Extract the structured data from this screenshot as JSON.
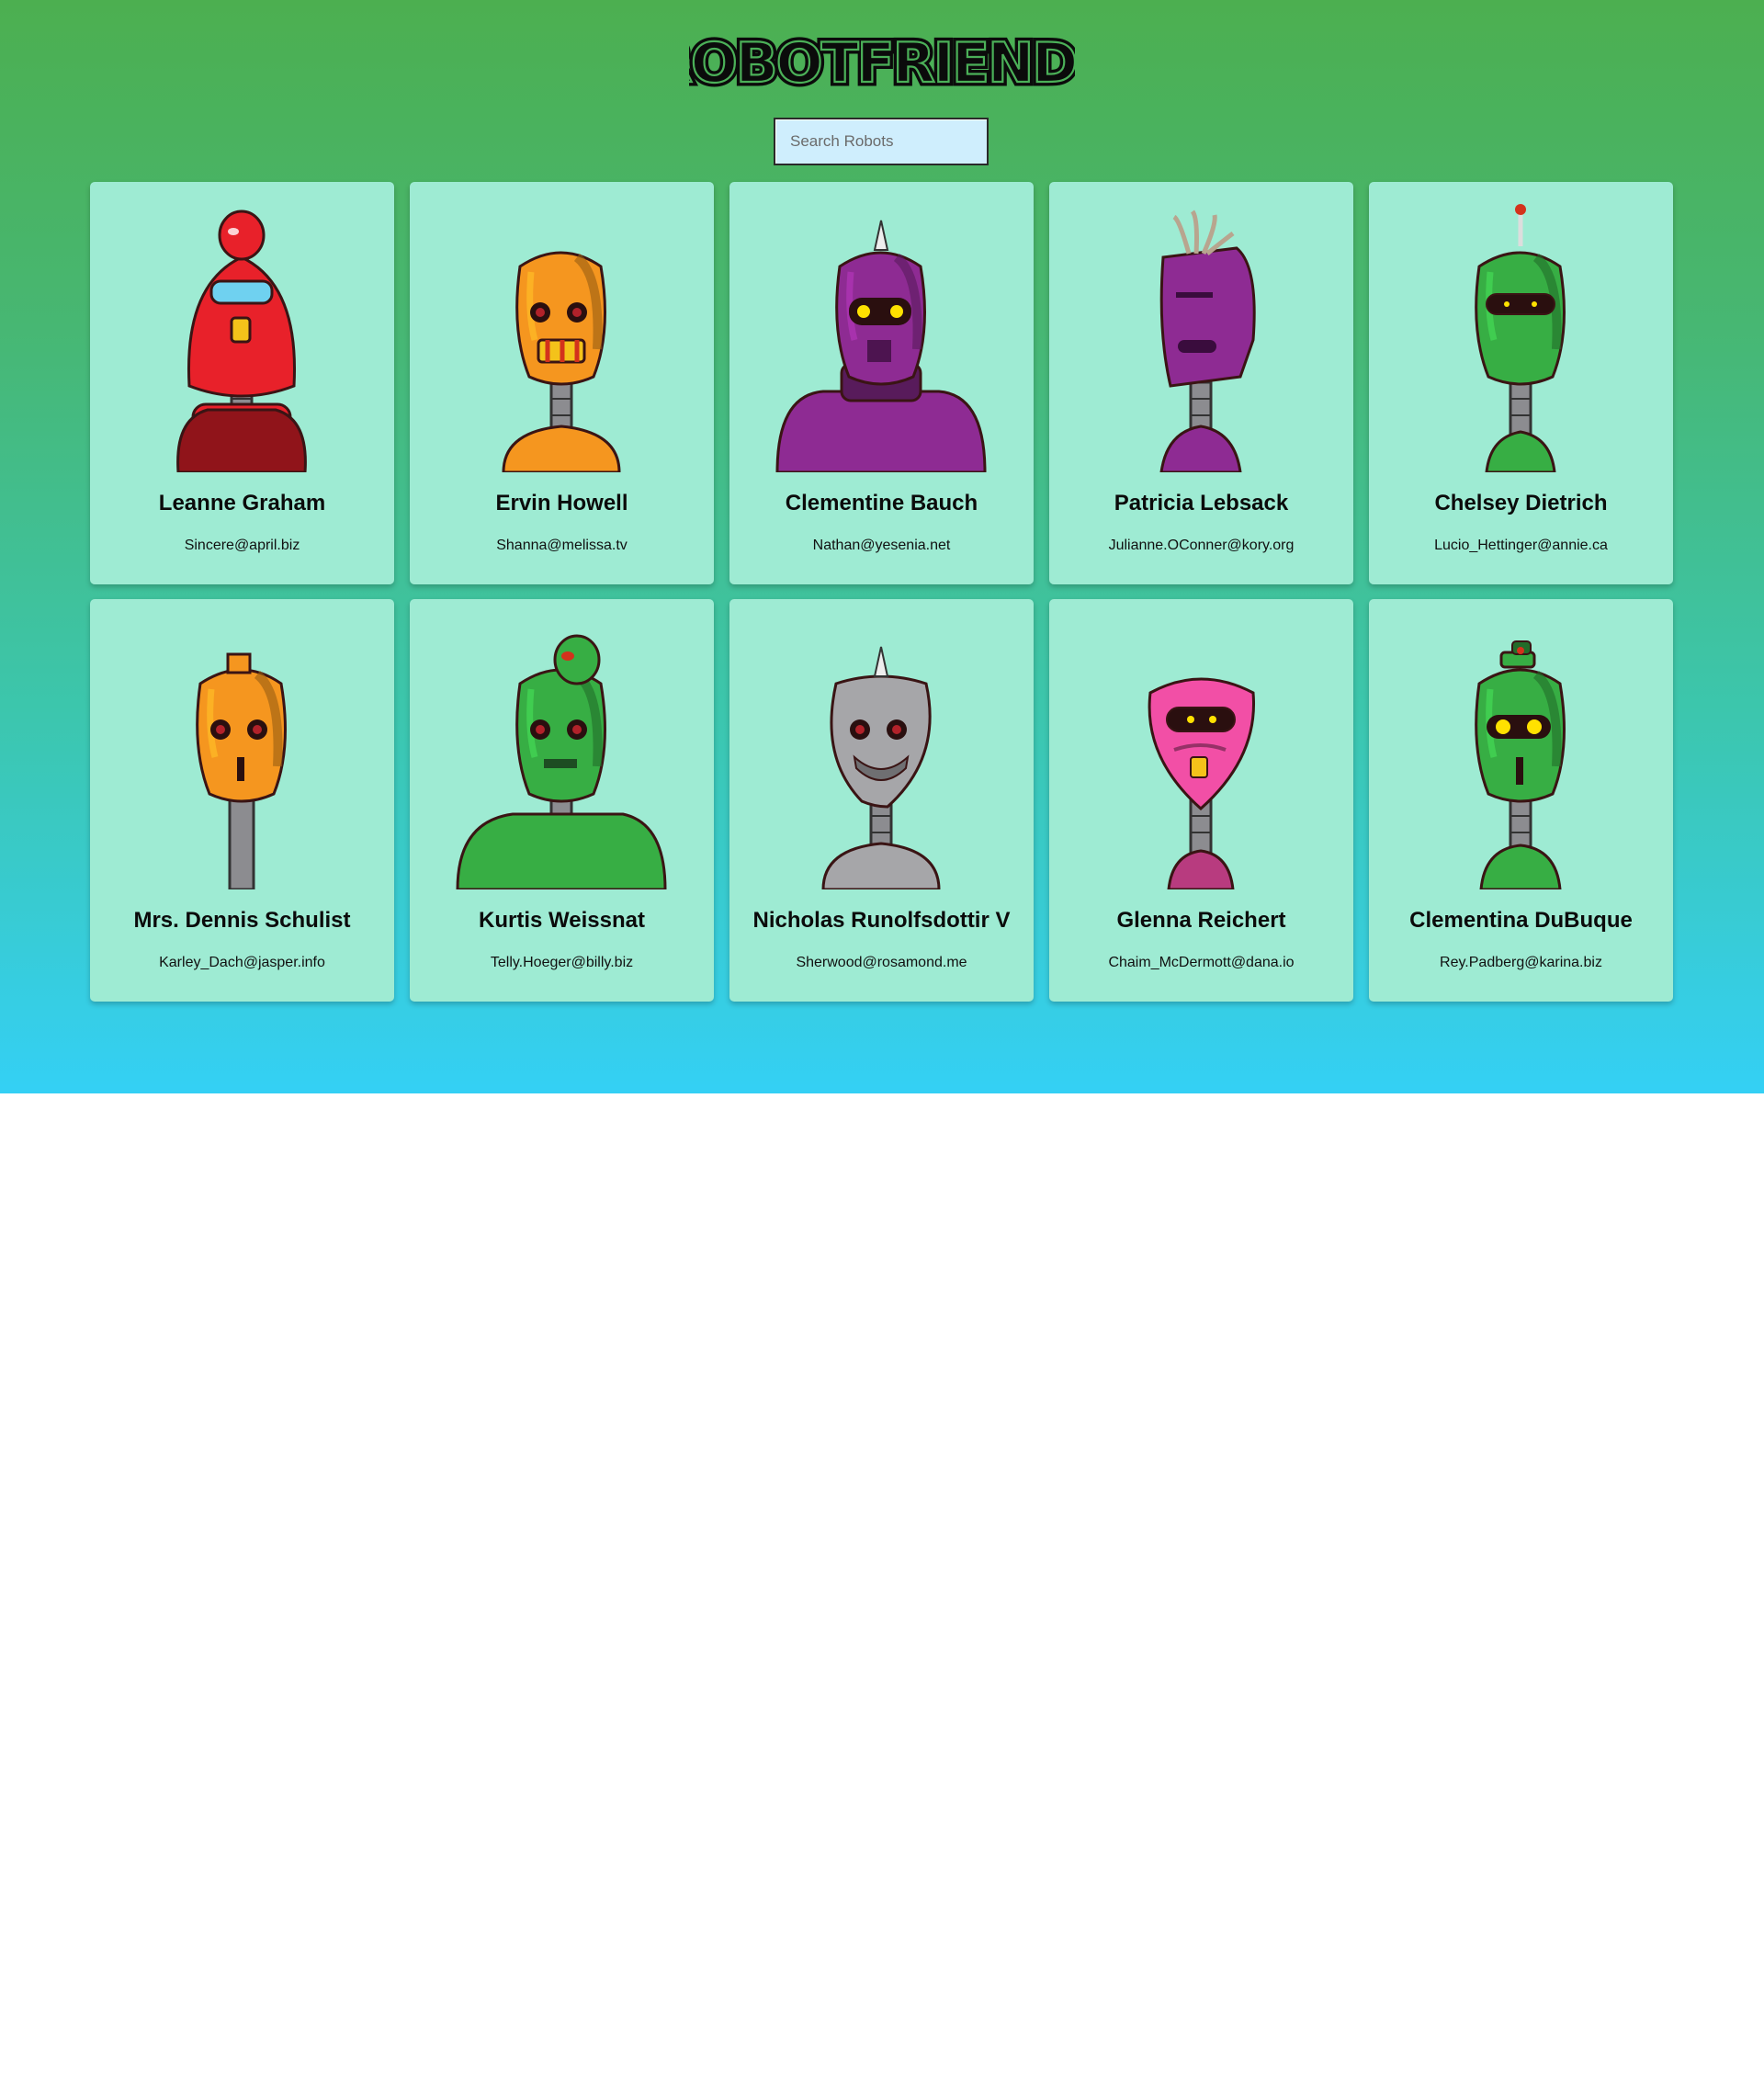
{
  "app": {
    "title": "ROBOTFRIENDS",
    "search_placeholder": "Search Robots",
    "search_value": ""
  },
  "robots": [
    {
      "name": "Leanne Graham",
      "email": "Sincere@april.biz",
      "avatar": "red-dome-robot-icon",
      "color": "#e8212a"
    },
    {
      "name": "Ervin Howell",
      "email": "Shanna@melissa.tv",
      "avatar": "orange-capsule-robot-icon",
      "color": "#f5961f"
    },
    {
      "name": "Clementine Bauch",
      "email": "Nathan@yesenia.net",
      "avatar": "purple-spike-robot-icon",
      "color": "#8e2b93"
    },
    {
      "name": "Patricia Lebsack",
      "email": "Julianne.OConner@kory.org",
      "avatar": "purple-box-robot-icon",
      "color": "#8e2b93"
    },
    {
      "name": "Chelsey Dietrich",
      "email": "Lucio_Hettinger@annie.ca",
      "avatar": "green-antenna-robot-icon",
      "color": "#37ae44"
    },
    {
      "name": "Mrs. Dennis Schulist",
      "email": "Karley_Dach@jasper.info",
      "avatar": "orange-round-robot-icon",
      "color": "#f5961f"
    },
    {
      "name": "Kurtis Weissnat",
      "email": "Telly.Hoeger@billy.biz",
      "avatar": "green-dome-robot-icon",
      "color": "#37ae44"
    },
    {
      "name": "Nicholas Runolfsdottir V",
      "email": "Sherwood@rosamond.me",
      "avatar": "gray-spike-robot-icon",
      "color": "#a6a6a9"
    },
    {
      "name": "Glenna Reichert",
      "email": "Chaim_McDermott@dana.io",
      "avatar": "pink-shield-robot-icon",
      "color": "#f24fa6"
    },
    {
      "name": "Clementina DuBuque",
      "email": "Rey.Padberg@karina.biz",
      "avatar": "green-hat-robot-icon",
      "color": "#37ae44"
    }
  ]
}
